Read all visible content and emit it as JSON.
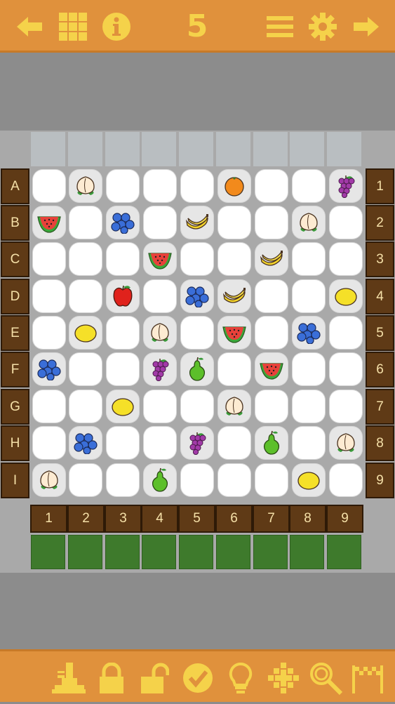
{
  "toolbar": {
    "level": "5",
    "icons": [
      "back-arrow-icon",
      "grid-icon",
      "info-icon",
      "menu-icon",
      "gear-icon",
      "forward-arrow-icon"
    ]
  },
  "grid": {
    "row_labels": [
      "A",
      "B",
      "C",
      "D",
      "E",
      "F",
      "G",
      "H",
      "I"
    ],
    "right_labels": [
      "1",
      "2",
      "3",
      "4",
      "5",
      "6",
      "7",
      "8",
      "9"
    ],
    "col_labels": [
      "1",
      "2",
      "3",
      "4",
      "5",
      "6",
      "7",
      "8",
      "9"
    ],
    "cells": [
      [
        "",
        "peach",
        "",
        "",
        "",
        "orange",
        "",
        "",
        "grapes"
      ],
      [
        "watermelon",
        "",
        "blueberries",
        "",
        "banana",
        "",
        "",
        "peach",
        ""
      ],
      [
        "",
        "",
        "",
        "watermelon",
        "",
        "",
        "banana",
        "",
        ""
      ],
      [
        "",
        "",
        "apple",
        "",
        "blueberries",
        "banana",
        "",
        "",
        "lemon"
      ],
      [
        "",
        "lemon",
        "",
        "peach",
        "",
        "watermelon",
        "",
        "blueberries",
        ""
      ],
      [
        "blueberries",
        "",
        "",
        "grapes",
        "pear",
        "",
        "watermelon",
        "",
        ""
      ],
      [
        "",
        "",
        "lemon",
        "",
        "",
        "peach",
        "",
        "",
        ""
      ],
      [
        "",
        "blueberries",
        "",
        "",
        "grapes",
        "",
        "pear",
        "",
        "peach"
      ],
      [
        "peach",
        "",
        "",
        "pear",
        "",
        "",
        "",
        "lemon",
        ""
      ]
    ]
  },
  "bottombar": {
    "icons": [
      "stamp-icon",
      "lock-icon",
      "unlock-icon",
      "check-icon",
      "hint-bulb-icon",
      "cross-pattern-icon",
      "search-icon",
      "finish-flag-icon"
    ]
  },
  "colors": {
    "bar": "#e0913c",
    "icon": "#f5d24a",
    "label_bg": "#5f3a16",
    "green_slot": "#3e7a2c"
  }
}
